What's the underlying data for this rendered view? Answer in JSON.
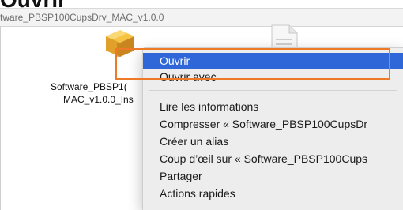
{
  "heading": {
    "text": "Ouvrir"
  },
  "window": {
    "title": "tware_PBSP100CupsDrv_MAC_v1.0.0"
  },
  "files": [
    {
      "label_line1": "Software_PBSP1(",
      "label_line2": "MAC_v1.0.0_Ins",
      "icon": "package-icon"
    },
    {
      "icon": "document-icon"
    }
  ],
  "context_menu": {
    "items": [
      {
        "label": "Ouvrir",
        "selected": true
      },
      {
        "label": "Ouvrir avec"
      },
      {
        "label": "Lire les informations"
      },
      {
        "label": "Compresser « Software_PBSP100CupsDr"
      },
      {
        "label": "Créer un alias"
      },
      {
        "label": "Coup d’œil sur « Software_PBSP100Cups"
      },
      {
        "label": "Partager"
      },
      {
        "label": "Actions rapides"
      }
    ]
  },
  "colors": {
    "selection": "#2f67d8",
    "annotation": "#ee7a27",
    "menu_background": "#ededed"
  }
}
